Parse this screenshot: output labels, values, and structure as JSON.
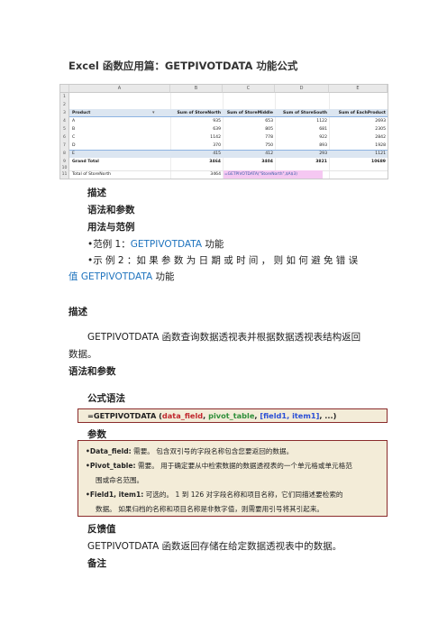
{
  "title": "Excel 函数应用篇：GETPIVOTDATA 功能公式",
  "sheet": {
    "col_headers": [
      "A",
      "B",
      "C",
      "D",
      "E"
    ],
    "row_numbers": [
      "1",
      "2",
      "3",
      "4",
      "5",
      "6",
      "7",
      "8",
      "9",
      "10",
      "11"
    ],
    "header": [
      "Product",
      "Sum of StoreNorth",
      "Sum of StoreMiddle",
      "Sum of StoreSouth",
      "Sum of EachProduct"
    ],
    "rows": [
      [
        "A",
        "935",
        "653",
        "1122",
        "2693"
      ],
      [
        "B",
        "639",
        "805",
        "681",
        "2305"
      ],
      [
        "C",
        "1142",
        "778",
        "922",
        "2842"
      ],
      [
        "D",
        "370",
        "750",
        "893",
        "1928"
      ],
      [
        "E",
        "415",
        "412",
        "293",
        "1121"
      ]
    ],
    "grand_total": [
      "Grand Total",
      "3464",
      "3404",
      "3821",
      "10689"
    ],
    "total_row": {
      "label": "Total of StoreNorth",
      "value": "3464",
      "formula": "=GETPIVOTDATA(\"StoreNorth\",$A$3)"
    },
    "colors": {
      "header_band": "#dce6f1",
      "formula_bg": "#f5c8f2"
    }
  },
  "toc": {
    "item1": "描述",
    "item2": "语法和参数",
    "item3": "用法与范例",
    "example1_prefix": "•范例 1：",
    "example1_link": "GETPIVOTDATA",
    "example1_suffix": " 功能",
    "example2_line1": "•示 例  2 ：如 果 参 数 为 日 期 或 时 间 ， 则 如 何 避 免 错 误",
    "example2_prefix": "值 ",
    "example2_link": "GETPIVOTDATA",
    "example2_suffix": " 功能"
  },
  "description": {
    "heading": "描述",
    "para_line1": "GETPIVOTDATA 函数查询数据透视表并根据数据透视表结构返回",
    "para_line2": "数据。"
  },
  "syntax": {
    "heading": "语法和参数",
    "formula_heading": "公式语法",
    "formula_prefix": "=GETPIVOTDATA (",
    "formula_arg1": "data_field",
    "formula_sep1": ", ",
    "formula_arg2": "pivot_table",
    "formula_sep2": ", ",
    "formula_arg3": "[field1, item1]",
    "formula_suffix": ", ...)",
    "params_heading": "参数",
    "params": [
      {
        "name": "•Data_field:",
        "desc": " 需要。 包含双引号的字段名称包含您要返回的数据。"
      },
      {
        "name": "•Pivot_table:",
        "desc": " 需要。 用于确定要从中检索数据的数据透视表的一个单元格或单元格范"
      },
      {
        "name": "",
        "desc": "围或命名范围。"
      },
      {
        "name": "•Field1, item1:",
        "desc": " 可选的。 1 到 126 对字段名称和项目名称，它们同描述要检索的"
      },
      {
        "name": "",
        "desc": "数据。 如果归档的名称和项目名称是非数字值，则需要用引号将其引起来。"
      }
    ]
  },
  "return": {
    "heading": "反馈值",
    "text": "GETPIVOTDATA 函数返回存储在给定数据透视表中的数据。"
  },
  "remarks": {
    "heading": "备注"
  }
}
